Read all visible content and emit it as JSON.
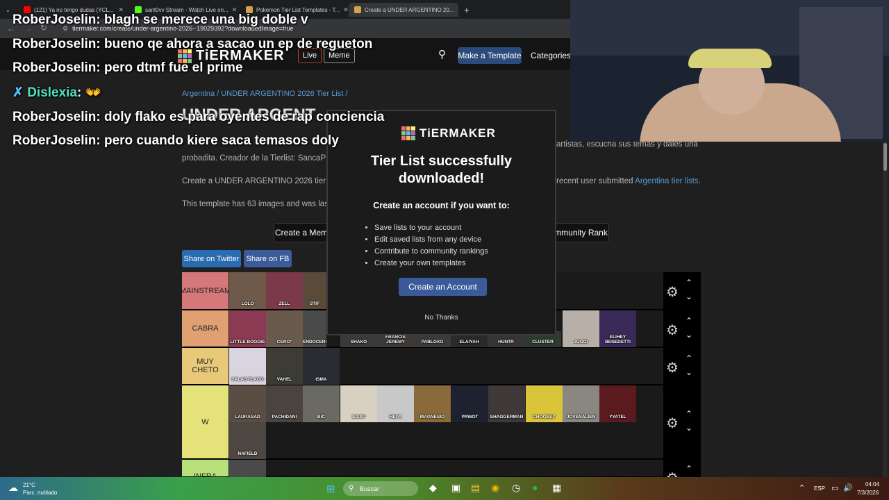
{
  "browser": {
    "tabs": [
      {
        "label": "(121) Ya no tengo dudas (YCL...",
        "color": "#ff0000"
      },
      {
        "label": "sant0vv Stream - Watch Live on...",
        "color": "#53fc18"
      },
      {
        "label": "Pokémon Tier List Templates - T...",
        "color": "#cfa44a"
      },
      {
        "label": "Create a UNDER ARGENTINO 20...",
        "color": "#cfa44a"
      }
    ],
    "url": "tiermaker.com/create/under-argentino-2026--19029392?downloadedImage=true"
  },
  "site": {
    "logo": "TiERMAKER",
    "nav_live": "Live",
    "nav_meme": "Meme",
    "make_template": "Make a Template",
    "categories": "Categories",
    "breadcrumb": "Argentina / UNDER ARGENTINO 2026 Tier List /",
    "page_title": "UNDER ARGENT",
    "desc1": "artistas, escucha sus temas y dales una",
    "desc2": "probadita. Creador de la Tierlist: SancaP",
    "create_text_a": "Create a UNDER ARGENTINO 2026 tier",
    "create_text_b": "recent user submitted",
    "create_text_link": "Argentina tier lists",
    "template_info": "This template has 63 images and was las",
    "create_meme": "Create a Mem",
    "community_rank": "mmunity Rank",
    "share_twitter": "Share on Twitter",
    "share_fb": "Share on FB"
  },
  "tiers": [
    {
      "label": "MAINSTREAM",
      "color": "#d4787a",
      "items": [
        "LOLO",
        "ZELL",
        "STIF"
      ]
    },
    {
      "label": "CABRA",
      "color": "#e0a072",
      "items": [
        "LITTLE BOOGIE",
        "CERO°",
        "ENDOCEROBULTO",
        "SHAKO",
        "FRANCIS JEREMY",
        "PABLOXO",
        "ELAIYAH",
        "HUNTR",
        "CLUSTER",
        "JUGO!",
        "ELIHEY BENEDETTI"
      ]
    },
    {
      "label": "MUY CHETO",
      "color": "#e8c97a",
      "items": [
        "SALAS FLACO",
        "VAHEL",
        "ISMA"
      ]
    },
    {
      "label": "W",
      "color": "#e6e27a",
      "items": [
        "LAURASAD",
        "PACHIDANI",
        "BIC",
        "SIXXP",
        "HEPA",
        "MAGNESIO",
        "PRWOT",
        "SHAGGERMAN",
        "CHOOSEY",
        "JOVENALIEN",
        "YYATEL",
        "NAFIELD"
      ]
    },
    {
      "label": "INFRA",
      "color": "#b9e07a",
      "items": [
        ""
      ]
    }
  ],
  "modal": {
    "logo": "TiERMAKER",
    "title": "Tier List successfully downloaded!",
    "subtitle": "Create an account if you want to:",
    "benefits": [
      "Save lists to your account",
      "Edit saved lists from any device",
      "Contribute to community rankings",
      "Create your own templates"
    ],
    "create_account": "Create an Account",
    "no_thanks": "No Thanks"
  },
  "chat": [
    {
      "user": "RoberJoselin",
      "msg": "blagh se merece una big doble v",
      "color": "#ffffff"
    },
    {
      "user": "RoberJoselin",
      "msg": "bueno qe ahora a sacao un ep de regueton",
      "color": "#ffffff"
    },
    {
      "user": "RoberJoselin",
      "msg": "pero dtmf fue el prime",
      "color": "#ffffff"
    },
    {
      "user": "Dislexia",
      "msg": "",
      "color": "#4fe0c0"
    },
    {
      "user": "RoberJoselin",
      "msg": "doly flako es para oyentes de rap conciencia",
      "color": "#ffffff"
    },
    {
      "user": "RoberJoselin",
      "msg": "pero cuando kiere saca temasos doly",
      "color": "#ffffff"
    }
  ],
  "taskbar": {
    "temp": "21°C",
    "weather": "Parc. nublado",
    "search": "Buscar",
    "lang": "ESP",
    "time": "04:04",
    "date": "7/3/2026"
  }
}
